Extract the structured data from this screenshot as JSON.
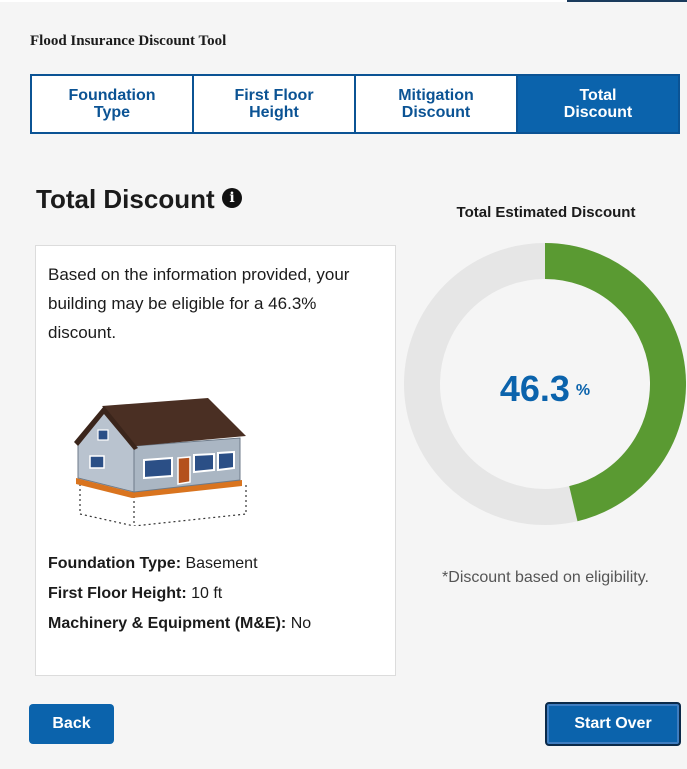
{
  "tool_title": "Flood Insurance Discount Tool",
  "tabs": [
    {
      "label": "Foundation\nType",
      "active": false
    },
    {
      "label": "First Floor\nHeight",
      "active": false
    },
    {
      "label": "Mitigation\nDiscount",
      "active": false
    },
    {
      "label": "Total\nDiscount",
      "active": true
    }
  ],
  "section_title": "Total Discount",
  "info_icon": "info-icon",
  "summary_text": "Based on the information provided, your building may be eligible for a 46.3% discount.",
  "details": {
    "foundation_label": "Foundation Type:",
    "foundation_value": "Basement",
    "height_label": "First Floor Height:",
    "height_value": "10 ft",
    "me_label": "Machinery & Equipment (M&E):",
    "me_value": "No"
  },
  "donut": {
    "title": "Total Estimated Discount",
    "value": "46.3",
    "unit": "%",
    "fraction": 0.463,
    "fill_color": "#5a9a32",
    "track_color": "#e6e6e6"
  },
  "eligibility_note": "*Discount based on eligibility.",
  "buttons": {
    "back": "Back",
    "start_over": "Start Over"
  },
  "colors": {
    "primary": "#0b63ac",
    "tab_border": "#0b5394"
  }
}
